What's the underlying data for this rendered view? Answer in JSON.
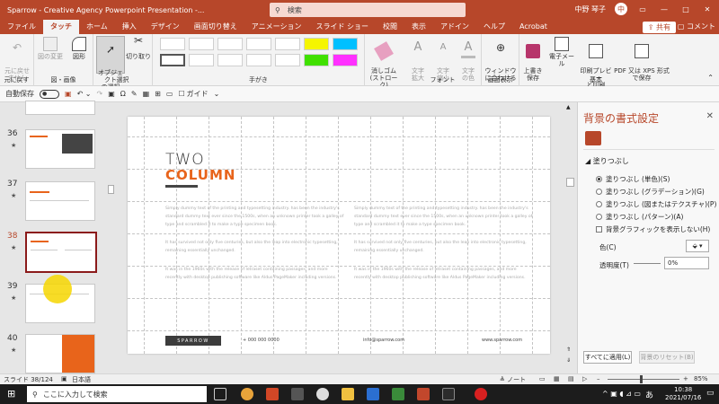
{
  "titlebar": {
    "title": "Sparrow - Creative Agency Powerpoint Presentation -...",
    "search_placeholder": "検索",
    "user": "中野 琴子",
    "avatar_initial": "中",
    "min": "—",
    "max": "□",
    "close": "✕"
  },
  "tabs": [
    "ファイル",
    "タッチ",
    "ホーム",
    "挿入",
    "デザイン",
    "画面切り替え",
    "アニメーション",
    "スライド ショー",
    "校閲",
    "表示",
    "アドイン",
    "ヘルプ",
    "Acrobat"
  ],
  "active_tab": "タッチ",
  "share_label": "共有",
  "comment_label": "コメント",
  "ribbon": {
    "undo": "元に戻す",
    "undo_sub": "元に戻せ\nません",
    "shapes_edit": "図の変更",
    "shapes": "図形",
    "object_select": "オブジェクト\nの選択",
    "cut": "切り取り",
    "eraser": "消しゴム\n(ストローク)",
    "text_enlarge": "文字\n拡大",
    "text_shrink": "文字\n縮小",
    "text_color": "文字\nの色",
    "fit_window": "ウィンドウ\nに合わせる",
    "save": "上書き\n保存",
    "email": "電子メール",
    "print_preview": "印刷プレビュー\nと印刷",
    "pdf_xps": "PDF 又は XPS 形式\nで保存",
    "groups": {
      "undo": "元に戻す",
      "figure": "図・画像",
      "select": "選択",
      "handwriting": "手がき",
      "font": "フォント",
      "display": "画面表示",
      "basic": "基本"
    }
  },
  "qat": {
    "autosave": "自動保存",
    "toggle": "オフ",
    "guide": "ガイド"
  },
  "thumbs": [
    {
      "num": "36"
    },
    {
      "num": "37"
    },
    {
      "num": "38"
    },
    {
      "num": "39"
    },
    {
      "num": "40"
    }
  ],
  "slide": {
    "title_line1": "TWO",
    "title_line2": "COLUMN",
    "para1": "Simply dummy text of the printing and typesetting industry. has been the industry's standard dummy text ever since the 1500s, when an unknown printer took a galley of type and scrambled it to make a type specimen book.",
    "para2": "It has survived not only five centuries, but also the leap into electronic typesetting, remaining essentially unchanged.",
    "para3": "It was in the 1960s with the release of letraset containing passages, and more recently with desktop publishing software like Aldus PageMaker including versions.",
    "para4": "Simply dummy text of the printing and typesetting industry. has been the industry's standard dummy text ever since the 1500s, when an unknown printer took a galley of type and scrambled it to make a type specimen book.",
    "para5": "It has survived not only five centuries, but also the leap into electronic typesetting, remaining essentially unchanged.",
    "para6": "It was in the 1960s with the release of letraset containing passages, and more recently with desktop publishing software like Aldus PageMaker including versions.",
    "footer_brand": "SPARROW",
    "footer_phone": "+ 000 000 0000",
    "footer_email": "info@sparrow.com",
    "footer_web": "www.sparrow.com"
  },
  "pane": {
    "title": "背景の書式設定",
    "close": "✕",
    "section": "塗りつぶし",
    "options": [
      "塗りつぶし (単色)(S)",
      "塗りつぶし (グラデーション)(G)",
      "塗りつぶし (図またはテクスチャ)(P)",
      "塗りつぶし (パターン)(A)"
    ],
    "hide_bg": "背景グラフィックを表示しない(H)",
    "color_label": "色(C)",
    "transparency_label": "透明度(T)",
    "transparency_value": "0%",
    "apply_all": "すべてに適用(L)",
    "reset_bg": "背景のリセット(B)"
  },
  "status": {
    "slide": "スライド 38/124",
    "lang": "日本語",
    "notes": "ノート",
    "zoom": "85%"
  },
  "taskbar": {
    "search": "ここに入力して検索",
    "time": "10:38",
    "date": "2021/07/16",
    "ime": "あ"
  },
  "colors": {
    "accent": "#b7472a",
    "orange": "#e8641b"
  }
}
